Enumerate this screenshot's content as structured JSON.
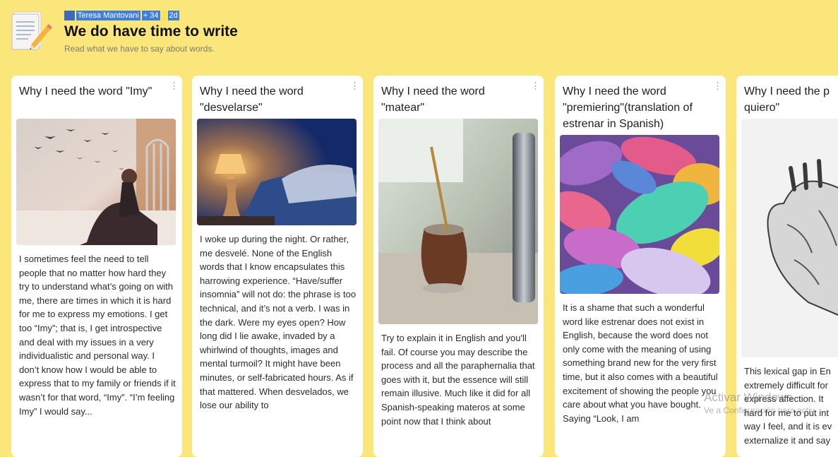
{
  "header": {
    "author": "Teresa Mantovani",
    "plus_count": "+ 34",
    "age": "2d",
    "title": "We do have time to write",
    "subtitle": "Read what we have to say about words."
  },
  "cards": [
    {
      "title": "Why I need the word \"Imy\"",
      "image_icon": "woman-reading-bed-birds-image",
      "text": "I sometimes feel the need to tell people that no matter how hard they try to understand what’s going on with me, there are times in which it is hard for me to express my emotions. I get too “Imy”; that is, I get introspective and deal with my issues in a very individualistic and personal way. I don’t know how I would be able to express that to my family or friends if it wasn’t for that word, “Imy”. “I’m feeling Imy” I would say..."
    },
    {
      "title": "Why I need the word \"desvelarse\"",
      "image_icon": "bedside-lamp-night-image",
      "text": "I woke up during the night. Or rather, me desvelé. None of the English words that I know encapsulates this harrowing experience. “Have/suffer insomnia” will not do: the phrase is too technical, and it’s not a verb. I was in the dark. Were my eyes open? How long did I lie awake, invaded by a whirlwind of thoughts, images and mental turmoil? It might have been minutes, or self-fabricated hours. As if that mattered. When desvelados, we lose our ability to"
    },
    {
      "title": "Why I need the word \"matear\"",
      "image_icon": "mate-gourd-thermos-image",
      "text": "Try to explain it in English and you'll fail.  Of course you may describe the process and all the paraphernalia that goes with it, but the essence will still remain illusive. Much like it did for all Spanish-speaking materos at some point now that I think about"
    },
    {
      "title": "Why I need the word \"premiering\"(translation of estrenar in Spanish)",
      "image_icon": "colorful-sneakers-pile-image",
      "text": "It is a shame that such a wonderful word like estrenar does not exist in English, because the word does not only come with the meaning of using something brand new for the very first time, but it also comes with a beautiful excitement of showing the people you care about what you have bought. Saying “Look, I am"
    },
    {
      "title": "Why I need the p quiero\"",
      "image_icon": "anatomical-heart-drawing-image",
      "text": "This lexical gap in En extremely difficult for express affection. It hard for me to put int way I feel, and it is ev externalize it and say"
    }
  ],
  "watermark": {
    "line1": "Activar Windows",
    "line2": "Ve a Configuración para activ"
  },
  "colors": {
    "background": "#fae67a",
    "card": "#ffffff",
    "highlight": "#3f7fd9"
  }
}
